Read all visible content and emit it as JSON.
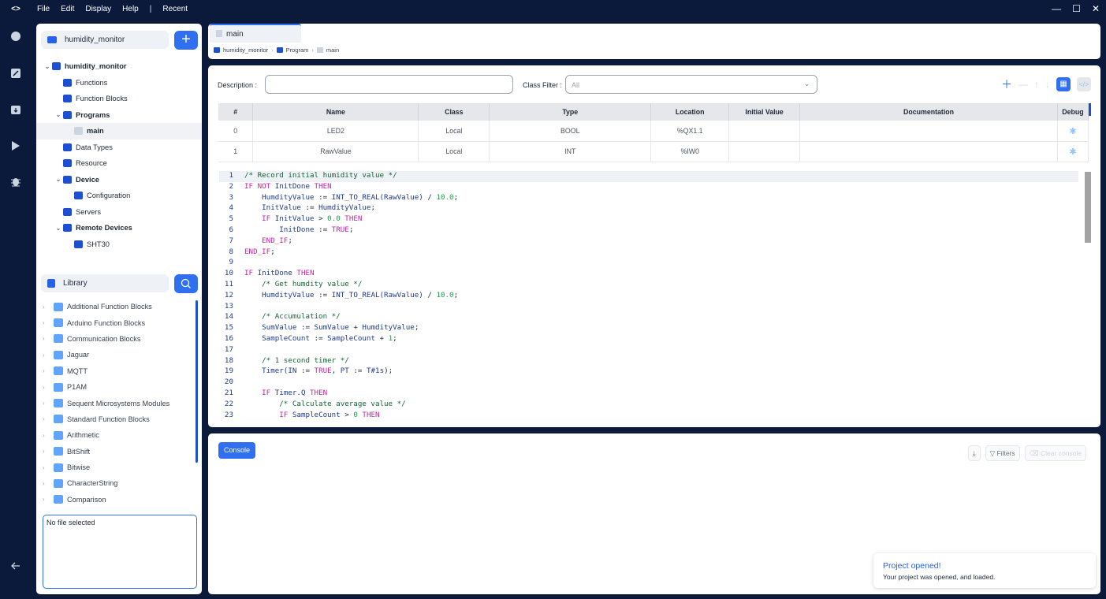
{
  "menu": {
    "logo": "<>",
    "file": "File",
    "edit": "Edit",
    "display": "Display",
    "help": "Help",
    "sep": "|",
    "recent": "Recent"
  },
  "window_controls": {
    "min": "—",
    "max": "☐",
    "close": "✕"
  },
  "activity": {
    "search": "search-icon",
    "switch": "switch-icon",
    "download": "download-icon",
    "run": "play-icon",
    "debug": "bug-icon",
    "back": "arrow-left-icon"
  },
  "sidebar": {
    "project_name": "humidity_monitor",
    "add_label": "+",
    "tree": [
      {
        "label": "humidity_monitor",
        "level": 0,
        "expanded": true,
        "bold": true
      },
      {
        "label": "Functions",
        "level": 1
      },
      {
        "label": "Function Blocks",
        "level": 1
      },
      {
        "label": "Programs",
        "level": 1,
        "expanded": true,
        "bold": true
      },
      {
        "label": "main",
        "level": 2,
        "selected": true,
        "bold": true
      },
      {
        "label": "Data Types",
        "level": 1
      },
      {
        "label": "Resource",
        "level": 1
      },
      {
        "label": "Device",
        "level": 1,
        "expanded": true,
        "bold": true
      },
      {
        "label": "Configuration",
        "level": 2
      },
      {
        "label": "Servers",
        "level": 1
      },
      {
        "label": "Remote Devices",
        "level": 1,
        "expanded": true,
        "bold": true
      },
      {
        "label": "SHT30",
        "level": 2
      }
    ],
    "library_title": "Library",
    "library_items": [
      "Additional Function Blocks",
      "Arduino Function Blocks",
      "Communication Blocks",
      "Jaguar",
      "MQTT",
      "P1AM",
      "Sequent Microsystems Modules",
      "Standard Function Blocks",
      "Arithmetic",
      "BitShift",
      "Bitwise",
      "CharacterString",
      "Comparison"
    ],
    "file_info": "No file selected"
  },
  "tabs": {
    "active": "main"
  },
  "breadcrumb": [
    "humidity_monitor",
    "Program",
    "main"
  ],
  "editor": {
    "description_label": "Description :",
    "description_value": "",
    "class_filter_label": "Class Filter :",
    "class_filter_value": "All",
    "columns": [
      "#",
      "Name",
      "Class",
      "Type",
      "Location",
      "Initial Value",
      "Documentation",
      "Debug"
    ],
    "rows": [
      [
        "0",
        "LED2",
        "Local",
        "BOOL",
        "%QX1.1",
        "",
        ""
      ],
      [
        "1",
        "RawValue",
        "Local",
        "INT",
        "%IW0",
        "",
        ""
      ]
    ]
  },
  "code": [
    [
      [
        "cc",
        "/* Record initial humidity value */"
      ]
    ],
    [
      [
        "kw",
        "IF NOT "
      ],
      [
        "id",
        "InitDone"
      ],
      [
        "kw",
        " THEN"
      ]
    ],
    [
      [
        "op",
        "    "
      ],
      [
        "id",
        "HumdityValue"
      ],
      [
        "op",
        " := "
      ],
      [
        "id",
        "INT_TO_REAL(RawValue)"
      ],
      [
        "op",
        " / "
      ],
      [
        "num",
        "10.0"
      ],
      [
        "op",
        ";"
      ]
    ],
    [
      [
        "op",
        "    "
      ],
      [
        "id",
        "InitValue"
      ],
      [
        "op",
        " := "
      ],
      [
        "id",
        "HumdityValue"
      ],
      [
        "op",
        ";"
      ]
    ],
    [
      [
        "op",
        "    "
      ],
      [
        "kw",
        "IF "
      ],
      [
        "id",
        "InitValue"
      ],
      [
        "op",
        " > "
      ],
      [
        "num",
        "0.0"
      ],
      [
        "kw",
        " THEN"
      ]
    ],
    [
      [
        "op",
        "        "
      ],
      [
        "id",
        "InitDone"
      ],
      [
        "op",
        " := "
      ],
      [
        "kw",
        "TRUE"
      ],
      [
        "op",
        ";"
      ]
    ],
    [
      [
        "op",
        "    "
      ],
      [
        "kw",
        "END_IF"
      ],
      [
        "op",
        ";"
      ]
    ],
    [
      [
        "kw",
        "END_IF"
      ],
      [
        "op",
        ";"
      ]
    ],
    [
      [
        "op",
        ""
      ]
    ],
    [
      [
        "kw",
        "IF "
      ],
      [
        "id",
        "InitDone"
      ],
      [
        "kw",
        " THEN"
      ]
    ],
    [
      [
        "op",
        "    "
      ],
      [
        "cc",
        "/* Get humdity value */"
      ]
    ],
    [
      [
        "op",
        "    "
      ],
      [
        "id",
        "HumdityValue"
      ],
      [
        "op",
        " := "
      ],
      [
        "id",
        "INT_TO_REAL(RawValue)"
      ],
      [
        "op",
        " / "
      ],
      [
        "num",
        "10.0"
      ],
      [
        "op",
        ";"
      ]
    ],
    [
      [
        "op",
        ""
      ]
    ],
    [
      [
        "op",
        "    "
      ],
      [
        "cc",
        "/* Accumulation */"
      ]
    ],
    [
      [
        "op",
        "    "
      ],
      [
        "id",
        "SumValue"
      ],
      [
        "op",
        " := "
      ],
      [
        "id",
        "SumValue"
      ],
      [
        "op",
        " + "
      ],
      [
        "id",
        "HumdityValue"
      ],
      [
        "op",
        ";"
      ]
    ],
    [
      [
        "op",
        "    "
      ],
      [
        "id",
        "SampleCount"
      ],
      [
        "op",
        " := "
      ],
      [
        "id",
        "SampleCount"
      ],
      [
        "op",
        " + "
      ],
      [
        "num",
        "1"
      ],
      [
        "op",
        ";"
      ]
    ],
    [
      [
        "op",
        ""
      ]
    ],
    [
      [
        "op",
        "    "
      ],
      [
        "cc",
        "/* 1 second timer */"
      ]
    ],
    [
      [
        "op",
        "    "
      ],
      [
        "id",
        "Timer(IN"
      ],
      [
        "op",
        " := "
      ],
      [
        "kw",
        "TRUE"
      ],
      [
        "op",
        ", "
      ],
      [
        "id",
        "PT"
      ],
      [
        "op",
        " := "
      ],
      [
        "id",
        "T#1s"
      ],
      [
        "op",
        ");"
      ]
    ],
    [
      [
        "op",
        ""
      ]
    ],
    [
      [
        "op",
        "    "
      ],
      [
        "kw",
        "IF "
      ],
      [
        "id",
        "Timer.Q"
      ],
      [
        "kw",
        " THEN"
      ]
    ],
    [
      [
        "op",
        "        "
      ],
      [
        "cc",
        "/* Calculate average value */"
      ]
    ],
    [
      [
        "op",
        "        "
      ],
      [
        "kw",
        "IF "
      ],
      [
        "id",
        "SampleCount"
      ],
      [
        "op",
        " > "
      ],
      [
        "num",
        "0"
      ],
      [
        "kw",
        " THEN"
      ]
    ]
  ],
  "console": {
    "tab": "Console",
    "download": "download-icon",
    "filters": "Filters",
    "clear": "Clear console"
  },
  "toast": {
    "title": "Project opened!",
    "message": "Your project was opened, and loaded."
  }
}
